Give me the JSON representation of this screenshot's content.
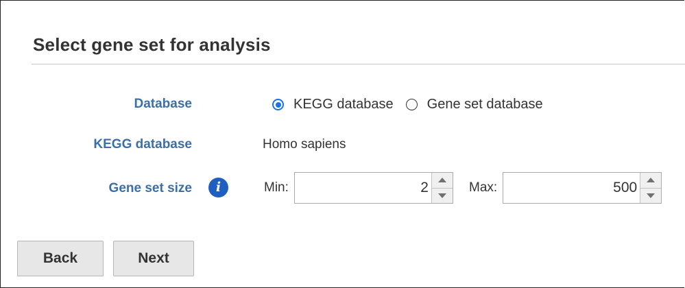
{
  "form": {
    "title": "Select gene set for analysis",
    "database": {
      "label": "Database",
      "options": [
        {
          "label": "KEGG database",
          "selected": true
        },
        {
          "label": "Gene set database",
          "selected": false
        }
      ]
    },
    "kegg": {
      "label": "KEGG database",
      "value": "Homo sapiens"
    },
    "gene_set_size": {
      "label": "Gene set size",
      "info_icon": "info-icon",
      "min_label": "Min:",
      "min_value": "2",
      "max_label": "Max:",
      "max_value": "500"
    }
  },
  "buttons": {
    "back": "Back",
    "next": "Next"
  },
  "colors": {
    "label": "#3b6fa7",
    "radio_accent": "#1a73e8",
    "info_icon": "#1f5fbf"
  }
}
